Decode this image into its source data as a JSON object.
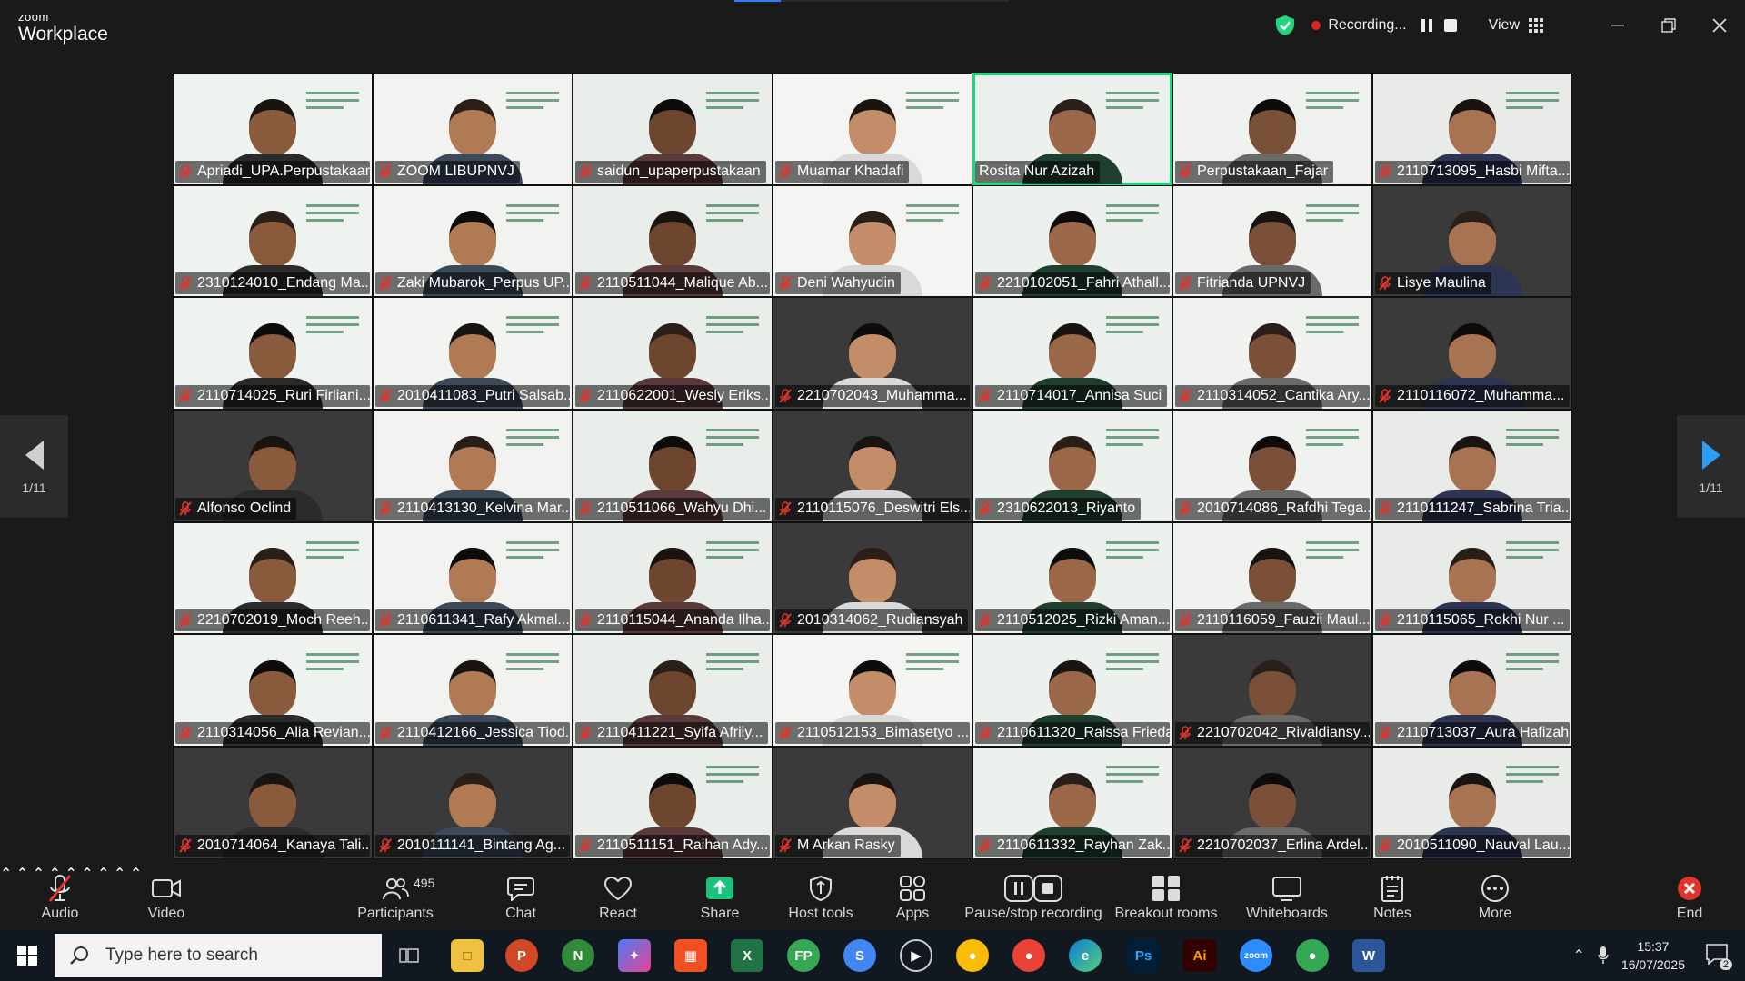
{
  "app": {
    "brand_small": "zoom",
    "brand_big": "Workplace"
  },
  "recording": {
    "label": "Recording...",
    "view_label": "View"
  },
  "share_progress": 0.17,
  "pager": {
    "left_page": "1/11",
    "right_page": "1/11"
  },
  "colors": {
    "accent_green": "#1fd67e",
    "mute_red": "#e0342c",
    "rec_red": "#e02424",
    "share_green": "#19c37d",
    "arrow_blue": "#2d9cf4"
  },
  "participants_grid": [
    {
      "name": "Apriadi_UPA.Perpustakaan",
      "muted": true
    },
    {
      "name": "ZOOM LIBUPNVJ",
      "muted": true
    },
    {
      "name": "saidun_upaperpustakaan",
      "muted": true
    },
    {
      "name": "Muamar Khadafi",
      "muted": true
    },
    {
      "name": "Rosita Nur Azizah",
      "muted": false,
      "active": true
    },
    {
      "name": "Perpustakaan_Fajar",
      "muted": true
    },
    {
      "name": "2110713095_Hasbi Mifta...",
      "muted": true
    },
    {
      "name": "2310124010_Endang Ma...",
      "muted": true
    },
    {
      "name": "Zaki Mubarok_Perpus UP...",
      "muted": true
    },
    {
      "name": "2110511044_Malique Ab...",
      "muted": true
    },
    {
      "name": "Deni Wahyudin",
      "muted": true
    },
    {
      "name": "2210102051_Fahri Athall...",
      "muted": true
    },
    {
      "name": "Fitrianda UPNVJ",
      "muted": true
    },
    {
      "name": "Lisye Maulina",
      "muted": true
    },
    {
      "name": "2110714025_Ruri Firliani...",
      "muted": true
    },
    {
      "name": "2010411083_Putri Salsab...",
      "muted": true
    },
    {
      "name": "2110622001_Wesly Eriks...",
      "muted": true
    },
    {
      "name": "2210702043_Muhamma...",
      "muted": true
    },
    {
      "name": "2110714017_Annisa Suci",
      "muted": true
    },
    {
      "name": "2110314052_Cantika Ary...",
      "muted": true
    },
    {
      "name": "2110116072_Muhamma...",
      "muted": true
    },
    {
      "name": "Alfonso Oclind",
      "muted": true
    },
    {
      "name": "2110413130_Kelvina Mar...",
      "muted": true
    },
    {
      "name": "2110511066_Wahyu Dhi...",
      "muted": true
    },
    {
      "name": "2110115076_Deswitri Els...",
      "muted": true
    },
    {
      "name": "2310622013_Riyanto",
      "muted": true
    },
    {
      "name": "2010714086_Rafdhi Tega...",
      "muted": true
    },
    {
      "name": "2110111247_Sabrina Tria...",
      "muted": true
    },
    {
      "name": "2210702019_Moch Reeh...",
      "muted": true
    },
    {
      "name": "2110611341_Rafy Akmal...",
      "muted": true
    },
    {
      "name": "2110115044_Ananda Ilha...",
      "muted": true
    },
    {
      "name": "2010314062_Rudiansyah",
      "muted": true
    },
    {
      "name": "2110512025_Rizki Aman...",
      "muted": true
    },
    {
      "name": "2110116059_Fauzii Maul...",
      "muted": true
    },
    {
      "name": "2110115065_Rokhi Nur ...",
      "muted": true
    },
    {
      "name": "2110314056_Alia Revian...",
      "muted": true
    },
    {
      "name": "2110412166_Jessica Tiod...",
      "muted": true
    },
    {
      "name": "2110411221_Syifa Afrily...",
      "muted": true
    },
    {
      "name": "2110512153_Bimasetyo ...",
      "muted": true
    },
    {
      "name": "2110611320_Raissa Frieda",
      "muted": true
    },
    {
      "name": "2210702042_Rivaldiansy...",
      "muted": true
    },
    {
      "name": "2110713037_Aura Hafizah",
      "muted": true
    },
    {
      "name": "2010714064_Kanaya Tali...",
      "muted": true
    },
    {
      "name": "2010111141_Bintang Ag...",
      "muted": true
    },
    {
      "name": "2110511151_Raihan Ady...",
      "muted": true
    },
    {
      "name": "M Arkan Rasky",
      "muted": true
    },
    {
      "name": "2110611332_Rayhan Zak...",
      "muted": true
    },
    {
      "name": "2210702037_Erlina Ardel...",
      "muted": true
    },
    {
      "name": "2010511090_Nauval Lau...",
      "muted": true
    }
  ],
  "toolbar": {
    "audio": "Audio",
    "video": "Video",
    "participants": "Participants",
    "participants_count": "495",
    "chat": "Chat",
    "react": "React",
    "share": "Share",
    "host_tools": "Host tools",
    "apps": "Apps",
    "pause_recording": "Pause/stop recording",
    "breakout": "Breakout rooms",
    "whiteboards": "Whiteboards",
    "notes": "Notes",
    "more": "More",
    "end": "End"
  },
  "taskbar": {
    "search_placeholder": "Type here to search",
    "time": "15:37",
    "date": "16/07/2025",
    "notification_count": "2"
  }
}
